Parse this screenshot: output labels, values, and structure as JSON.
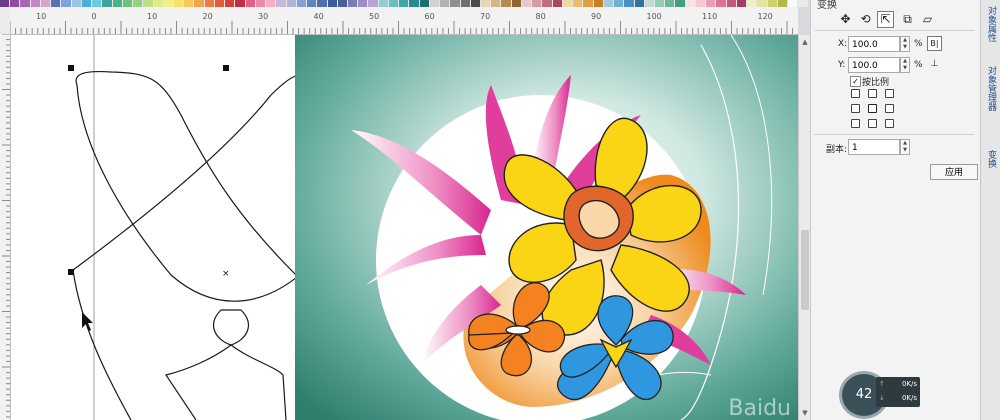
{
  "palette": {
    "colors": [
      "#6c3d8f",
      "#8d4ea3",
      "#a867b3",
      "#c589c2",
      "#d7a6cf",
      "#5b6fb6",
      "#7da3d8",
      "#9cc3e8",
      "#4caed8",
      "#71c8e6",
      "#3da699",
      "#4bb58a",
      "#6cc27a",
      "#98d27b",
      "#c0de82",
      "#e1eb8a",
      "#f4ef8d",
      "#f7e06b",
      "#f4c95a",
      "#f0a44c",
      "#ea7d3f",
      "#e45b3a",
      "#d9403b",
      "#c42e43",
      "#e45f8a",
      "#ea89aa",
      "#f1b0c6",
      "#c8b7dd",
      "#aeb4d8",
      "#8b9fd0",
      "#6083c3",
      "#4e6fb0",
      "#3d5aa0",
      "#49609a",
      "#7b7bb5",
      "#9a8ec5",
      "#b6a7d6",
      "#8dd0cf",
      "#64c2c1",
      "#3aa8a9",
      "#2a8b8d",
      "#1f6e70",
      "#d1d1d1",
      "#b3b3b3",
      "#8f8f8f",
      "#6f6f6f",
      "#4c4c4c",
      "#e9d6b3",
      "#d5b582",
      "#b58b55",
      "#8f6437",
      "#e8c7cc",
      "#d89aa6",
      "#c26d81",
      "#a94760",
      "#f2d8a1",
      "#eabf6b",
      "#de9f3f",
      "#c77f26",
      "#a1c9e2",
      "#75aed3",
      "#4a8fc0",
      "#2e72a8",
      "#bfe0d0",
      "#95cdb4",
      "#6cb798",
      "#489d7c",
      "#f6e3e6",
      "#f3c9d3",
      "#e99fb3",
      "#dc7396",
      "#c9567e",
      "#a63c66",
      "#f0f0c8",
      "#e4e49c",
      "#cfd070",
      "#b4b84a",
      "#fafafa",
      "#eaeaea"
    ]
  },
  "ruler": {
    "h_ticks": [
      "10",
      "0",
      "10",
      "20",
      "30",
      "40",
      "50",
      "60",
      "70",
      "80",
      "90",
      "100",
      "110",
      "120"
    ],
    "v_ticks": [
      "0",
      "10",
      "20",
      "30",
      "40",
      "50",
      "60"
    ]
  },
  "panel": {
    "title": "变换",
    "tool_icons": [
      {
        "name": "position-icon",
        "glyph": "✥"
      },
      {
        "name": "rotate-icon",
        "glyph": "⟲"
      },
      {
        "name": "scale-mirror-icon",
        "glyph": "⇱"
      },
      {
        "name": "size-icon",
        "glyph": "⧉"
      },
      {
        "name": "skew-icon",
        "glyph": "▱"
      }
    ],
    "x_label": "X:",
    "x_value": "100.0",
    "y_label": "Y:",
    "y_value": "100.0",
    "unit": "%",
    "proportional_label": "按比例",
    "proportional_checked": true,
    "copies_label": "副本:",
    "copies_value": "1",
    "apply_label": "应用",
    "mirror_h_icon": "mirror-horizontal-icon",
    "mirror_v_icon": "mirror-vertical-icon"
  },
  "side_tabs": {
    "tab1": "对象属性",
    "tab2": "对象管理器",
    "tab3": "变换"
  },
  "netmeter": {
    "percent": "42",
    "up": "0K/s",
    "down": "0K/s"
  }
}
